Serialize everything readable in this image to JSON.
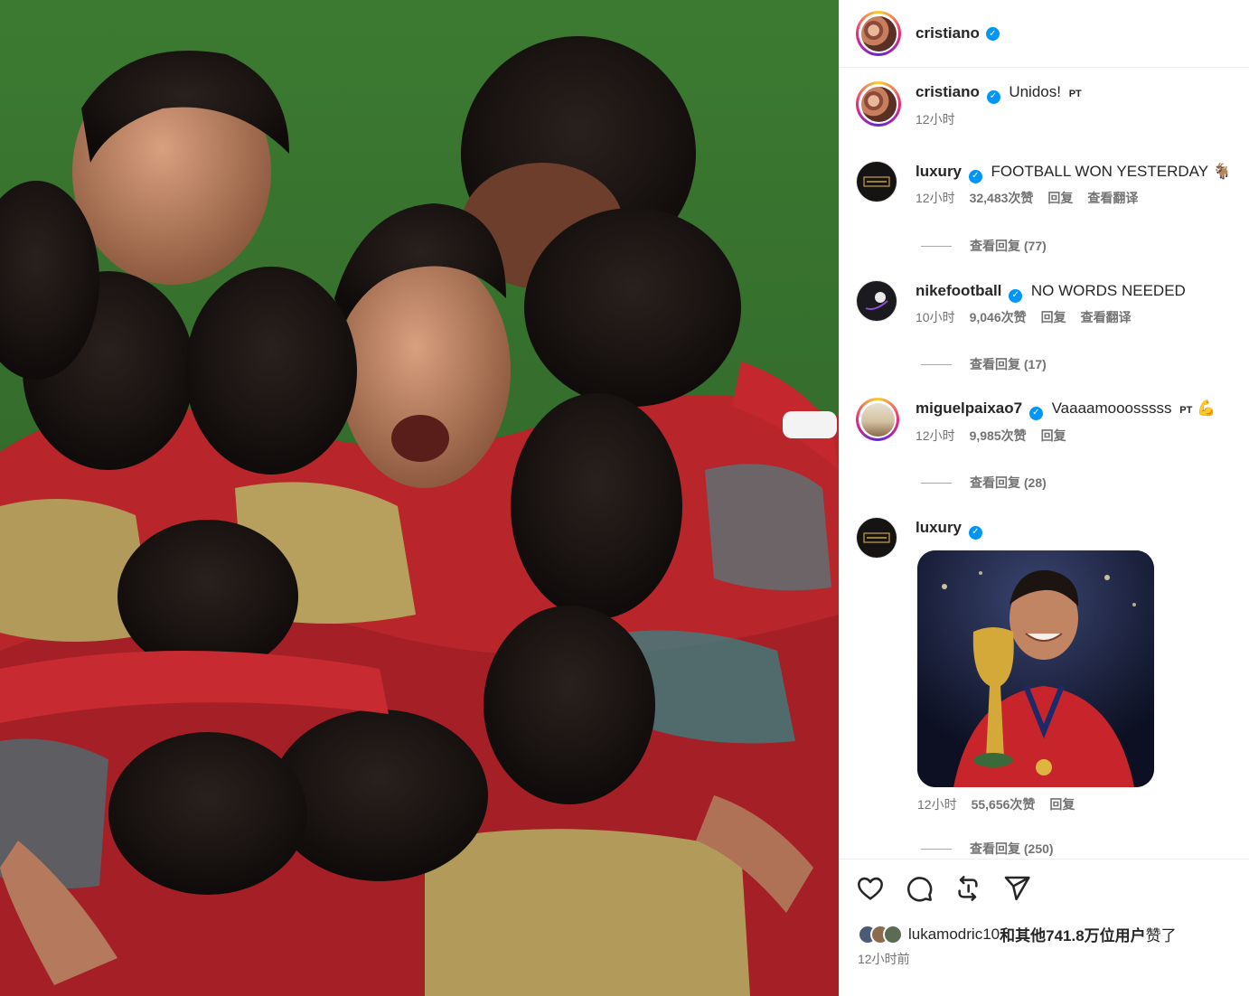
{
  "post": {
    "author": "cristiano",
    "caption": "Unidos!",
    "caption_lang": "PT",
    "caption_time": "12小时"
  },
  "comments": [
    {
      "user": "luxury",
      "text": "FOOTBALL WON YESTERDAY 🐐",
      "time": "12小时",
      "likes": "32,483次赞",
      "reply": "回复",
      "translate": "查看翻译",
      "view_replies": "查看回复 (77)"
    },
    {
      "user": "nikefootball",
      "text": "NO WORDS NEEDED",
      "time": "10小时",
      "likes": "9,046次赞",
      "reply": "回复",
      "translate": "查看翻译",
      "view_replies": "查看回复 (17)"
    },
    {
      "user": "miguelpaixao7",
      "text": "Vaaaamooosssss",
      "lang": "PT",
      "emoji": "💪",
      "time": "12小时",
      "likes": "9,985次赞",
      "reply": "回复",
      "view_replies": "查看回复 (28)"
    },
    {
      "user": "luxury",
      "time": "12小时",
      "likes": "55,656次赞",
      "reply": "回复",
      "view_replies": "查看回复 (250)"
    }
  ],
  "actions": {
    "icons": [
      "heart-icon",
      "comment-icon",
      "repost-icon",
      "share-icon"
    ],
    "liked_by_user": "lukamodric10",
    "liked_by_rest": "和其他741.8万位用户",
    "liked_suffix": "赞了",
    "posted_ago": "12小时前"
  },
  "colors": {
    "verified": "#0095f6",
    "secondary_text": "#737373",
    "jersey_red": "#c8242b"
  }
}
